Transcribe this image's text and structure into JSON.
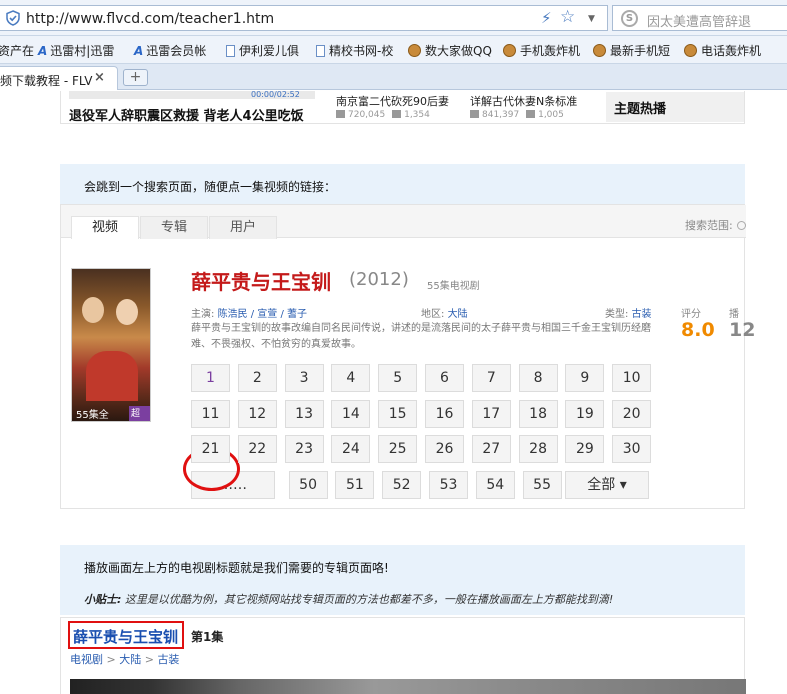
{
  "browser": {
    "url": "http://www.flvcd.com/teacher1.htm",
    "search_placeholder": "因太美遭高管辞退",
    "bookmarks": [
      "资产在",
      "迅雷村|迅雷",
      "迅雷会员帐",
      "伊利爱儿俱",
      "精校书网-校",
      "数大家做QQ",
      "手机轰炸机",
      "最新手机短",
      "电话轰炸机"
    ],
    "tab_label": "频下载教程 - FLV",
    "tab_close": "×",
    "new_tab": "+"
  },
  "strip": {
    "player_time": "00:00/02:52",
    "headline": "退役军人辞职震区救援 背老人4公里吃饭",
    "videos": [
      {
        "title": "南京富二代砍死90后妻",
        "views": "720,045",
        "comments": "1,354"
      },
      {
        "title": "详解古代休妻N条标准",
        "views": "841,397",
        "comments": "1,005"
      }
    ],
    "hot_topic": "主题热播"
  },
  "instruction1": "会跳到一个搜索页面，随便点一集视频的链接：",
  "result": {
    "tabs": [
      "视频",
      "专辑",
      "用户"
    ],
    "search_range_label": "搜索范围:",
    "poster_episodes": "55集全",
    "poster_hd": "超清",
    "title": "薛平贵与王宝钏",
    "year": "(2012)",
    "episode_count": "55集电视剧",
    "starring_label": "主演:",
    "starring": "陈浩民 / 宣萱 / 蓍子",
    "region_label": "地区:",
    "region": "大陆",
    "genre_label": "类型:",
    "genre": "古装",
    "description": "薛平贵与王宝钏的故事改编自同名民间传说，讲述的是流落民间的太子薛平贵与相国三千金王宝钏历经磨难、不畏强权、不怕贫穷的真爱故事。",
    "rating_label": "评分",
    "rating": "8.0",
    "play_label": "播",
    "play_value": "12",
    "episodes": [
      "1",
      "2",
      "3",
      "4",
      "5",
      "6",
      "7",
      "8",
      "9",
      "10",
      "11",
      "12",
      "13",
      "14",
      "15",
      "16",
      "17",
      "18",
      "19",
      "20",
      "21",
      "22",
      "23",
      "24",
      "25",
      "26",
      "27",
      "28",
      "29",
      "30"
    ],
    "more_label": "……",
    "last_episodes": [
      "50",
      "51",
      "52",
      "53",
      "54",
      "55"
    ],
    "all_label": "全部 ▾"
  },
  "instruction2": "播放画面左上方的电视剧标题就是我们需要的专辑页面咯!",
  "tip_label": "小贴士:",
  "tip_text": "这里是以优酷为例，其它视频网站找专辑页面的方法也都差不多，一般在播放画面左上方都能找到滴!",
  "player": {
    "title": "薛平贵与王宝钏",
    "episode": "第1集",
    "crumb": [
      "电视剧",
      "大陆",
      "古装"
    ]
  }
}
